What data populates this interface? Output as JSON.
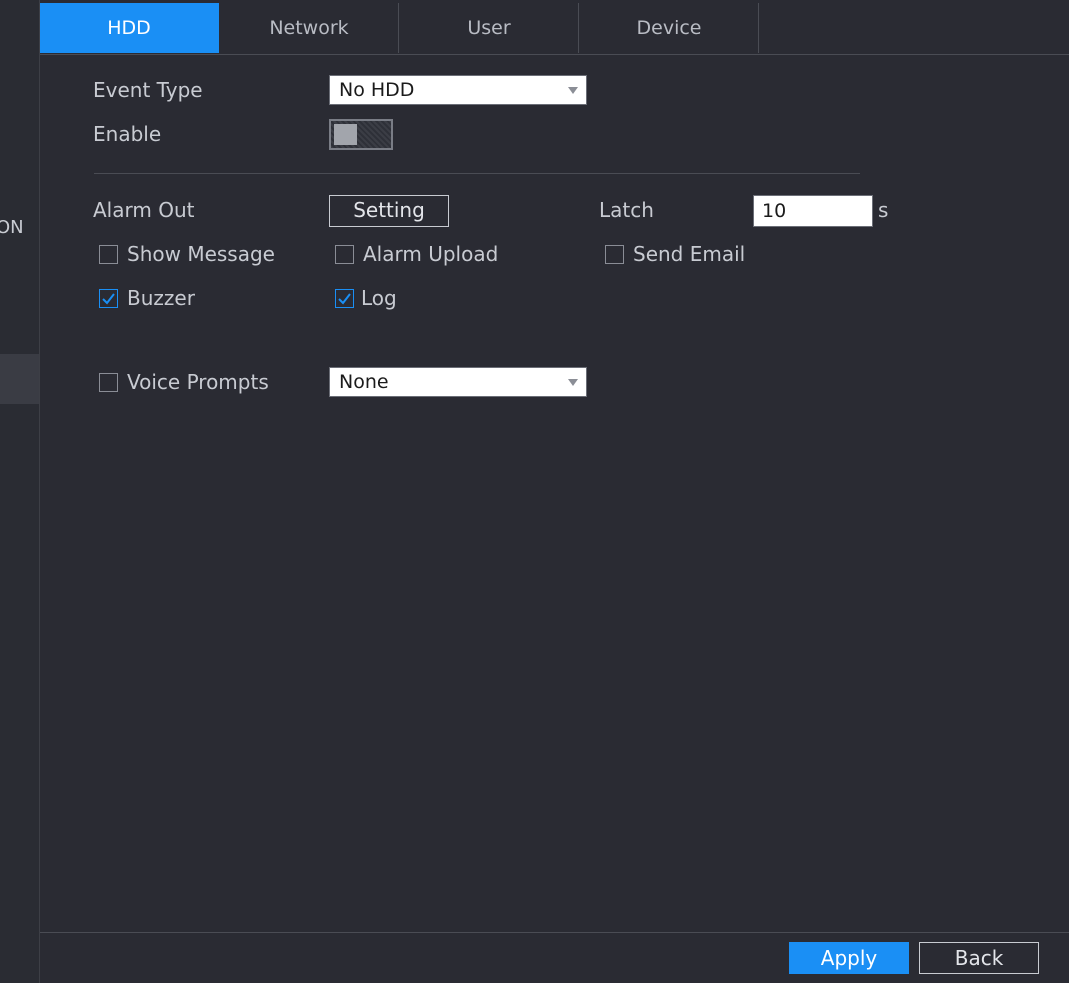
{
  "sidebar": {
    "partial_label": "ON"
  },
  "tabs": [
    {
      "label": "HDD",
      "active": true
    },
    {
      "label": "Network",
      "active": false
    },
    {
      "label": "User",
      "active": false
    },
    {
      "label": "Device",
      "active": false
    }
  ],
  "form": {
    "event_type_label": "Event Type",
    "event_type_value": "No HDD",
    "enable_label": "Enable",
    "enable_on": false,
    "alarm_out_label": "Alarm Out",
    "setting_button": "Setting",
    "latch_label": "Latch",
    "latch_value": "10",
    "latch_unit": "s",
    "show_message_label": "Show Message",
    "show_message_checked": false,
    "alarm_upload_label": "Alarm Upload",
    "alarm_upload_checked": false,
    "send_email_label": "Send Email",
    "send_email_checked": false,
    "buzzer_label": "Buzzer",
    "buzzer_checked": true,
    "log_label": "Log",
    "log_checked": true,
    "voice_prompts_label": "Voice Prompts",
    "voice_prompts_checked": false,
    "voice_prompts_value": "None"
  },
  "footer": {
    "apply": "Apply",
    "back": "Back"
  },
  "colors": {
    "accent": "#1a8ff5",
    "panel": "#2a2b33"
  }
}
